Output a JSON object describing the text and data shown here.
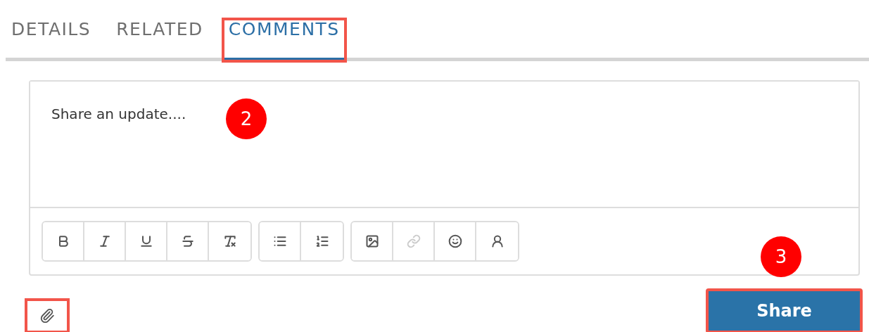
{
  "tabs": [
    {
      "label": "DETAILS",
      "selected": false,
      "highlighted": false
    },
    {
      "label": "RELATED",
      "selected": false,
      "highlighted": false
    },
    {
      "label": "COMMENTS",
      "selected": true,
      "highlighted": true
    }
  ],
  "editor": {
    "placeholder": "Share an update....",
    "callout": "2",
    "toolbar": [
      [
        {
          "kind": "bold",
          "disabled": false
        },
        {
          "kind": "italic",
          "disabled": false
        },
        {
          "kind": "underline",
          "disabled": false
        },
        {
          "kind": "strike",
          "disabled": false
        },
        {
          "kind": "clear",
          "disabled": false
        }
      ],
      [
        {
          "kind": "bullets",
          "disabled": false
        },
        {
          "kind": "numbers",
          "disabled": false
        }
      ],
      [
        {
          "kind": "image",
          "disabled": false
        },
        {
          "kind": "link",
          "disabled": true
        },
        {
          "kind": "emoji",
          "disabled": false
        },
        {
          "kind": "mention",
          "disabled": false
        }
      ]
    ]
  },
  "attach": {
    "highlighted": true
  },
  "share": {
    "label": "Share",
    "highlighted": true,
    "callout": "3"
  }
}
